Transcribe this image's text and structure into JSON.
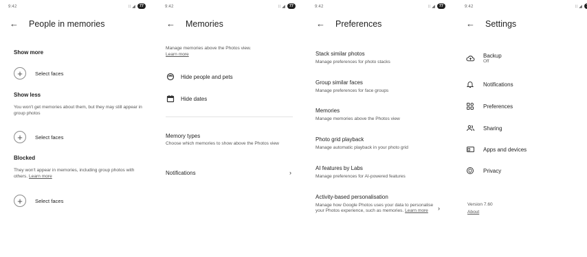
{
  "status_bar": {
    "time": "9:42",
    "left_icons": "⁝⁝ ☁ ✓ •",
    "signal": "⁝⁝ ◢",
    "battery": "77"
  },
  "people": {
    "title": "People in memories",
    "show_more": {
      "heading": "Show more",
      "action": "Select faces"
    },
    "show_less": {
      "heading": "Show less",
      "desc": "You won't get memories about them, but they may still appear in group photos",
      "action": "Select faces"
    },
    "blocked": {
      "heading": "Blocked",
      "desc": "They won't appear in memories, including group photos with others.",
      "link": "Learn more",
      "action": "Select faces"
    }
  },
  "memories": {
    "title": "Memories",
    "intro": "Manage memories above the Photos view.",
    "intro_link": "Learn more",
    "hide_people": "Hide people and pets",
    "hide_dates": "Hide dates",
    "memory_types": {
      "title": "Memory types",
      "desc": "Choose which memories to show above the Photos view"
    },
    "notifications": "Notifications"
  },
  "preferences": {
    "title": "Preferences",
    "items": [
      {
        "title": "Stack similar photos",
        "desc": "Manage preferences for photo stacks"
      },
      {
        "title": "Group similar faces",
        "desc": "Manage preferences for face groups"
      },
      {
        "title": "Memories",
        "desc": "Manage memories above the Photos view"
      },
      {
        "title": "Photo grid playback",
        "desc": "Manage automatic playback in your photo grid"
      },
      {
        "title": "AI features by Labs",
        "desc": "Manage preferences for AI-powered features"
      }
    ],
    "activity": {
      "title": "Activity-based personalisation",
      "desc": "Manage how Google Photos uses your data to personalise your Photos experience, such as memories.",
      "link": "Learn more"
    }
  },
  "settings": {
    "title": "Settings",
    "backup": {
      "label": "Backup",
      "sub": "Off"
    },
    "notifications": "Notifications",
    "preferences": "Preferences",
    "sharing": "Sharing",
    "apps": "Apps and devices",
    "privacy": "Privacy",
    "version": "Version 7.60",
    "about": "About"
  }
}
